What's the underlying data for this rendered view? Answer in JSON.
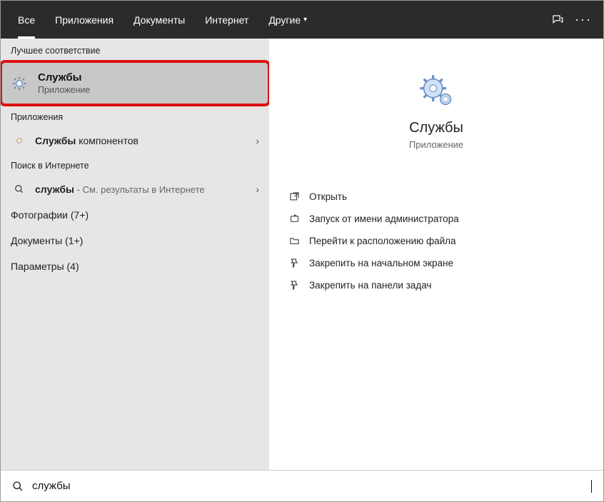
{
  "header": {
    "tabs": [
      "Все",
      "Приложения",
      "Документы",
      "Интернет",
      "Другие"
    ],
    "active": 0
  },
  "left": {
    "best_match_label": "Лучшее соответствие",
    "best_match": {
      "title": "Службы",
      "subtitle": "Приложение"
    },
    "apps_label": "Приложения",
    "app_row": {
      "bold": "Службы",
      "rest": " компонентов"
    },
    "web_label": "Поиск в Интернете",
    "web_row": {
      "bold": "службы",
      "rest": " - См. результаты в Интернете"
    },
    "rows": [
      "Фотографии (7+)",
      "Документы (1+)",
      "Параметры (4)"
    ]
  },
  "preview": {
    "title": "Службы",
    "subtitle": "Приложение",
    "actions": [
      "Открыть",
      "Запуск от имени администратора",
      "Перейти к расположению файла",
      "Закрепить на начальном экране",
      "Закрепить на панели задач"
    ]
  },
  "search": {
    "value": "службы"
  }
}
